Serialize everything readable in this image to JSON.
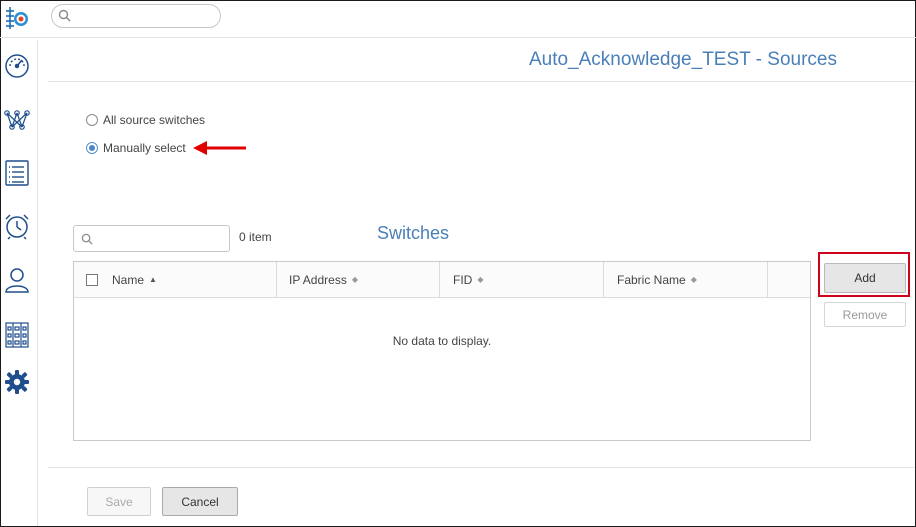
{
  "search": {
    "placeholder": ""
  },
  "header": {
    "title": "Auto_Acknowledge_TEST - Sources"
  },
  "sidebar": {
    "items": [
      {
        "icon": "dashboard-gauge-icon"
      },
      {
        "icon": "topology-network-icon"
      },
      {
        "icon": "list-report-icon"
      },
      {
        "icon": "alarm-clock-icon"
      },
      {
        "icon": "user-icon"
      },
      {
        "icon": "inventory-grid-icon"
      },
      {
        "icon": "settings-gear-icon",
        "active": true
      }
    ]
  },
  "source_options": {
    "all_label": "All source switches",
    "manual_label": "Manually select",
    "selected": "manual"
  },
  "switches": {
    "title": "Switches",
    "search_placeholder": "",
    "item_count": "0 item",
    "columns": [
      "Name",
      "IP Address",
      "FID",
      "Fabric Name"
    ],
    "sorted_column": "Name",
    "empty_message": "No data to display."
  },
  "actions": {
    "add_label": "Add",
    "remove_label": "Remove"
  },
  "footer": {
    "save_label": "Save",
    "cancel_label": "Cancel"
  },
  "colors": {
    "accent": "#4a7fb8",
    "highlight": "#d0021b",
    "icon_blue": "#1f6fb8"
  }
}
